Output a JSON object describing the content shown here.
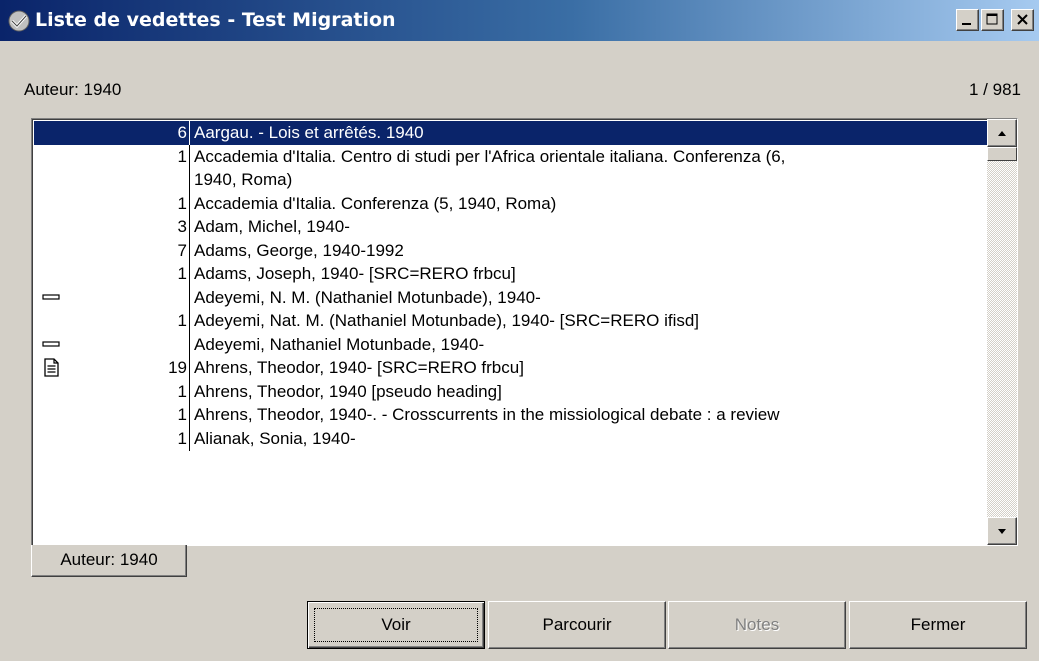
{
  "window": {
    "title": "Liste de vedettes - Test Migration",
    "icon": "catalog-app-icon"
  },
  "header": {
    "left": "Auteur: 1940",
    "right": "1 / 981"
  },
  "list": {
    "rows": [
      {
        "count": "6",
        "text": "Aargau. - Lois et arrêtés. 1940",
        "selected": true,
        "icon": ""
      },
      {
        "count": "1",
        "text": "Accademia d'Italia. Centro di studi per l'Africa orientale italiana. Conferenza (6,",
        "icon": ""
      },
      {
        "count": "",
        "text": "1940, Roma)",
        "icon": "",
        "continuation": true
      },
      {
        "count": "1",
        "text": "Accademia d'Italia. Conferenza (5, 1940, Roma)",
        "icon": ""
      },
      {
        "count": "3",
        "text": "Adam, Michel, 1940-",
        "icon": ""
      },
      {
        "count": "7",
        "text": "Adams, George, 1940-1992",
        "icon": ""
      },
      {
        "count": "1",
        "text": "Adams, Joseph, 1940-  [SRC=RERO frbcu]",
        "icon": ""
      },
      {
        "count": "",
        "text": "Adeyemi, N. M. (Nathaniel Motunbade), 1940-",
        "icon": "see-reference-icon"
      },
      {
        "count": "1",
        "text": "Adeyemi, Nat. M. (Nathaniel Motunbade), 1940-  [SRC=RERO ifisd]",
        "icon": ""
      },
      {
        "count": "",
        "text": "Adeyemi, Nathaniel Motunbade, 1940-",
        "icon": "see-reference-icon"
      },
      {
        "count": "19",
        "text": "Ahrens, Theodor, 1940-  [SRC=RERO frbcu]",
        "icon": "authority-record-icon"
      },
      {
        "count": "1",
        "text": "Ahrens, Theodor, 1940  [pseudo heading]",
        "icon": ""
      },
      {
        "count": "1",
        "text": "Ahrens, Theodor, 1940-. - Crosscurrents in the missiological debate : a review",
        "icon": ""
      },
      {
        "count": "1",
        "text": "Alianak, Sonia, 1940-",
        "icon": ""
      }
    ]
  },
  "tab": {
    "label": "Auteur: 1940"
  },
  "buttons": {
    "voir": "Voir",
    "parcourir": "Parcourir",
    "notes": "Notes",
    "fermer": "Fermer"
  },
  "colors": {
    "selection": "#0a246a",
    "titlebar_start": "#0a246a",
    "titlebar_end": "#a6caf0",
    "face": "#d4d0c8"
  }
}
